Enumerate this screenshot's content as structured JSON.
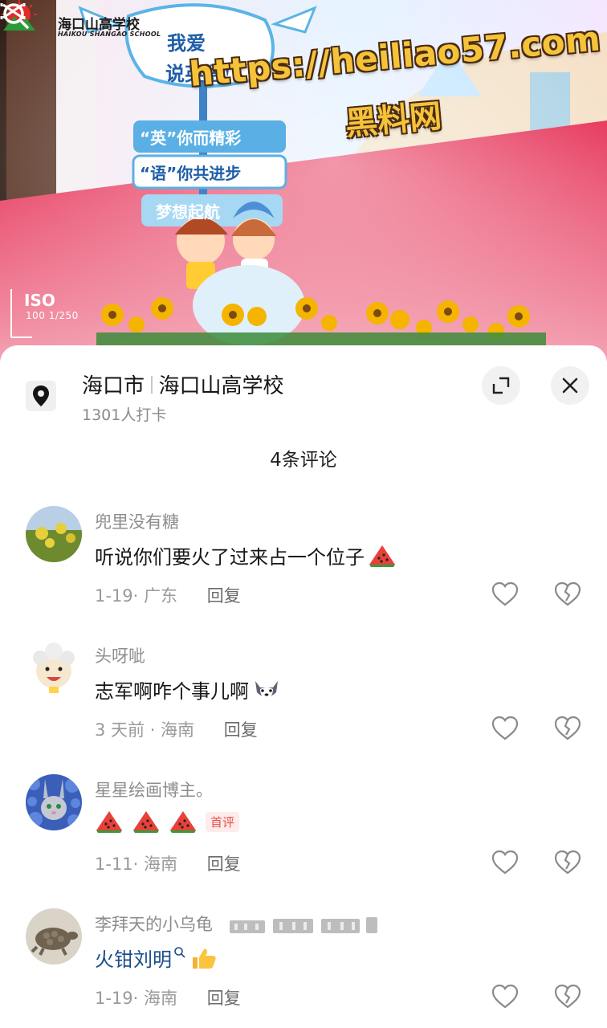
{
  "photo": {
    "school_name_cn": "海口山高学校",
    "school_name_en": "HAIKOU SHANGAO SCHOOL",
    "sign_lines": [
      "我爱",
      "说英语!",
      "“英”你而精彩",
      "“语”你共进步",
      "梦想起航"
    ],
    "watermark_url": "https://heiliao57.com",
    "watermark_name": "黑料网",
    "iso_label": "ISO",
    "iso_value": "100 1/250",
    "camera_icon": "camera-flip-icon",
    "edit_icon": "capcut-icon"
  },
  "location": {
    "pin_icon": "location-pin-icon",
    "city": "海口市",
    "place": "海口山高学校",
    "checkins": "1301人打卡"
  },
  "actions": {
    "expand_icon": "expand-icon",
    "close_icon": "close-icon"
  },
  "comments_header": "4条评论",
  "comments": [
    {
      "author": "兜里没有糖",
      "text": "听说你们要火了过来占一个位子",
      "emoji": "watermelon-emoji",
      "meta": "1-19· 广东",
      "reply": "回复"
    },
    {
      "author": "头呀呲",
      "text": "志军啊咋个事儿啊",
      "emoji": "husky-emoji",
      "meta": "3 天前 · 海南",
      "reply": "回复"
    },
    {
      "author": "星星绘画博主。",
      "text": "",
      "emoji": "watermelon-emoji",
      "badge": "首评",
      "meta": "1-11· 海南",
      "reply": "回复"
    },
    {
      "author": "李拜天的小乌龟",
      "text": "火钳刘明",
      "emoji": "thumbs-up-emoji",
      "meta": "1-19· 海南",
      "reply": "回复"
    }
  ],
  "colors": {
    "accent_red": "#e8504f",
    "link_blue": "#1b4d8c",
    "watermark_gold": "#f5c33a"
  }
}
